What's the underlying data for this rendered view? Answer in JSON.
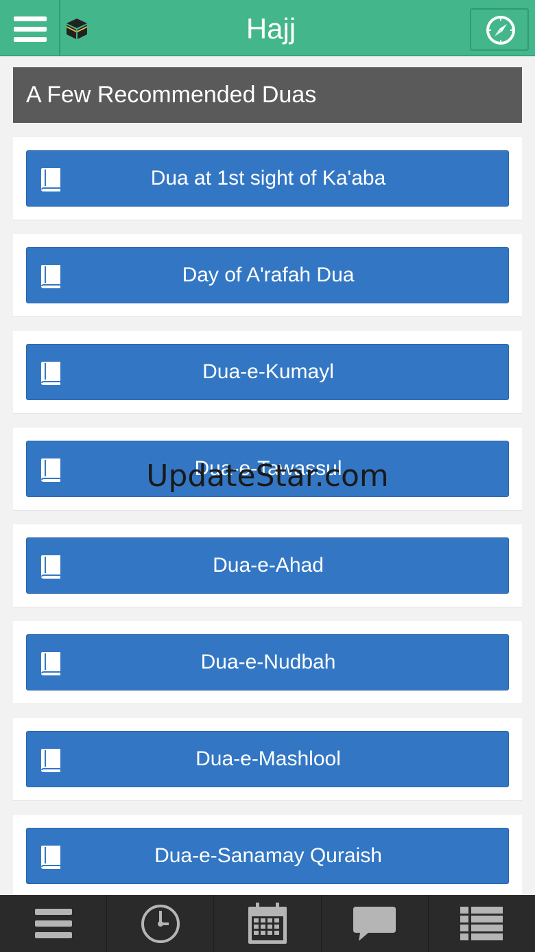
{
  "header": {
    "title": "Hajj",
    "menu_icon": "hamburger-menu-icon",
    "app_icon": "kaaba-icon",
    "compass_icon": "qibla-compass-icon"
  },
  "section": {
    "title": "A Few Recommended Duas"
  },
  "duas": [
    {
      "label": "Dua at 1st sight of Ka'aba"
    },
    {
      "label": "Day of A'rafah Dua"
    },
    {
      "label": "Dua-e-Kumayl"
    },
    {
      "label": "Dua-e-Tawassul"
    },
    {
      "label": "Dua-e-Ahad"
    },
    {
      "label": "Dua-e-Nudbah"
    },
    {
      "label": "Dua-e-Mashlool"
    },
    {
      "label": "Dua-e-Sanamay Quraish"
    }
  ],
  "watermark": "UpdateStar.com",
  "tabbar": {
    "tabs": [
      {
        "icon": "menu-lines-icon"
      },
      {
        "icon": "clock-icon"
      },
      {
        "icon": "calendar-icon"
      },
      {
        "icon": "chat-bubble-icon"
      },
      {
        "icon": "list-icon"
      }
    ]
  },
  "colors": {
    "header_green": "#43b78b",
    "section_gray": "#5a5a5a",
    "button_blue": "#3377c4",
    "tabbar_dark": "#2a2a2a"
  }
}
